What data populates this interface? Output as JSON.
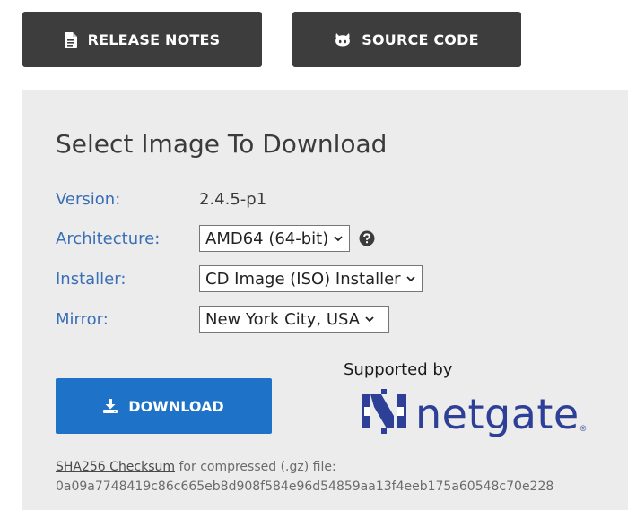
{
  "top_buttons": {
    "release_notes": {
      "label": "RELEASE NOTES",
      "icon": "document-icon"
    },
    "source_code": {
      "label": "SOURCE CODE",
      "icon": "github-octocat-icon"
    }
  },
  "panel": {
    "title": "Select Image To Download",
    "version": {
      "label": "Version:",
      "value": "2.4.5-p1"
    },
    "architecture": {
      "label": "Architecture:",
      "selected": "AMD64 (64-bit)",
      "help_icon": "question-circle-icon"
    },
    "installer": {
      "label": "Installer:",
      "selected": "CD Image (ISO) Installer"
    },
    "mirror": {
      "label": "Mirror:",
      "selected": "New York City, USA"
    },
    "download_button": {
      "label": "DOWNLOAD",
      "icon": "download-icon"
    },
    "sponsor": {
      "supported_by": "Supported by",
      "brand": "netgate",
      "reg_mark": "®"
    },
    "checksum": {
      "link_text": "SHA256 Checksum",
      "suffix": " for compressed (.gz) file:",
      "hash": "0a09a7748419c86c665eb8d908f584e96d54859aa13f4eeb175a60548c70e228"
    }
  },
  "colors": {
    "dark_button": "#3d3d3d",
    "panel_bg": "#ececec",
    "label_blue": "#3a6fb5",
    "download_blue": "#1e73c8",
    "netgate_blue": "#2d3f96"
  }
}
